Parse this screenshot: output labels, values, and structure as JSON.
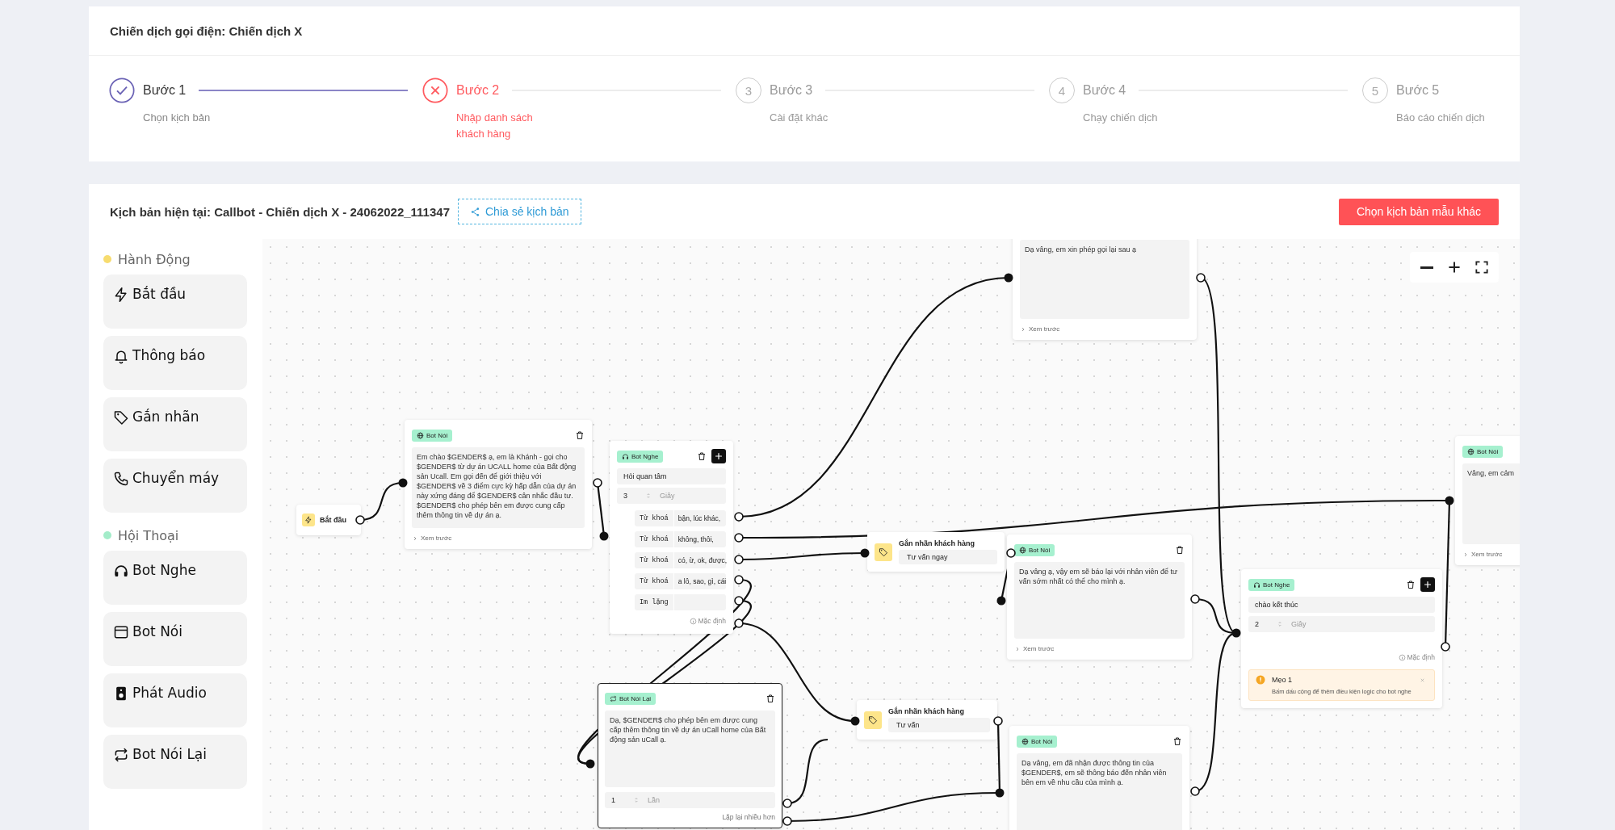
{
  "campaign": {
    "title": "Chiến dịch gọi điện: Chiến dịch X"
  },
  "steps": [
    {
      "label": "Bước 1",
      "caption": "Chọn kịch bản",
      "kind": "done"
    },
    {
      "label": "Bước 2",
      "caption": "Nhập danh sách khách hàng",
      "kind": "error"
    },
    {
      "number": "3",
      "label": "Bước 3",
      "caption": "Cài đặt khác",
      "kind": "pending"
    },
    {
      "number": "4",
      "label": "Bước 4",
      "caption": "Chạy chiến dịch",
      "kind": "pending"
    },
    {
      "number": "5",
      "label": "Bước 5",
      "caption": "Báo cáo chiến dịch",
      "kind": "pending"
    }
  ],
  "script_header": {
    "title": "Kịch bản hiện tại: Callbot - Chiến dịch X - 24062022_111347",
    "share_button": "Chia sẻ kịch bản",
    "choose_button": "Chọn kịch bản mẫu khác"
  },
  "palette": [
    {
      "group": "Hành Động",
      "color": "#f7dc6f",
      "items": [
        {
          "kind": "start",
          "label": "Bắt đầu"
        },
        {
          "kind": "notify",
          "label": "Thông báo"
        },
        {
          "kind": "tag",
          "label": "Gắn nhãn"
        },
        {
          "kind": "transfer",
          "label": "Chuyển máy"
        }
      ]
    },
    {
      "group": "Hội Thoại",
      "color": "#a3ecc9",
      "items": [
        {
          "kind": "listen",
          "label": "Bot Nghe"
        },
        {
          "kind": "speak",
          "label": "Bot Nói"
        },
        {
          "kind": "audio",
          "label": "Phát Audio"
        },
        {
          "kind": "repeat",
          "label": "Bot Nói Lại"
        }
      ]
    }
  ],
  "canvas": {
    "nodes": [
      {
        "kind": "start",
        "label": "Bắt đầu",
        "selected": false
      },
      {
        "kind": "speak",
        "badge": "Bot Nói",
        "text": "Em chào $GENDER$ ạ, em là Khánh - gọi cho $GENDER$ từ dự án UCALL home của Bất động sản Ucall. Em gọi đến để giới thiệu với $GENDER$ về 3 điểm cực kỳ hấp dẫn của dự án này xứng đáng để $GENDER$ cân nhắc đầu tư. $GENDER$ cho phép bên em được cung cấp thêm thông tin về dự án ạ.",
        "preview": "Xem trước",
        "selected": false
      },
      {
        "kind": "listen",
        "badge": "Bot Nghe",
        "intent": "Hỏi quan tâm",
        "wait": "3",
        "unit": "Giây",
        "branches": [
          {
            "label": "Từ khoá",
            "value": "bận, lúc khác,"
          },
          {
            "label": "Từ khoá",
            "value": "không, thôi,"
          },
          {
            "label": "Từ khoá",
            "value": "có, ừ, ok, được,"
          },
          {
            "label": "Từ khoá",
            "value": "a lô, sao, gì, cái"
          },
          {
            "label": "Im lặng"
          }
        ],
        "default": "Mặc định",
        "selected": false
      },
      {
        "kind": "speak",
        "text": "Dạ vâng, em xin phép gọi lại sau ạ",
        "preview": "Xem trước",
        "selected": false
      },
      {
        "kind": "tag",
        "title": "Gắn nhãn khách hàng",
        "value": "Tư vấn ngay",
        "selected": false
      },
      {
        "kind": "speak",
        "badge": "Bot Nói",
        "text": "Dạ vâng ạ, vậy em sẽ báo lại với nhân viên để tư vấn sớm nhất có thể cho mình ạ.",
        "preview": "Xem trước",
        "selected": false
      },
      {
        "kind": "listen",
        "badge": "Bot Nghe",
        "intent": "chào kết thúc",
        "wait": "2",
        "unit": "Giây",
        "default": "Mặc định",
        "tip": {
          "title": "Mẹo 1",
          "text": "Bấm dấu cộng để thêm điều kiện logic cho bot nghe"
        },
        "selected": false
      },
      {
        "kind": "speak",
        "badge": "Bot Nói",
        "text": "Vâng, em cảm",
        "preview": "Xem trước",
        "selected": false
      },
      {
        "kind": "repeat",
        "badge": "Bot Nói Lại",
        "text": "Dạ, $GENDER$ cho phép bên em được cung cấp thêm thông tin về dự án uCall home của Bất động sản uCall ạ.",
        "count": "1",
        "unit": "Lần",
        "more": "Lặp lại nhiều hơn",
        "selected": true
      },
      {
        "kind": "tag",
        "title": "Gắn nhãn khách hàng",
        "value": "Tư vấn",
        "selected": false
      },
      {
        "kind": "speak",
        "badge": "Bot Nói",
        "text": "Dạ vâng, em đã nhận được thông tin của $GENDER$, em sẽ thông báo đến nhân viên bên em về nhu cầu của mình ạ.",
        "selected": false
      }
    ]
  }
}
